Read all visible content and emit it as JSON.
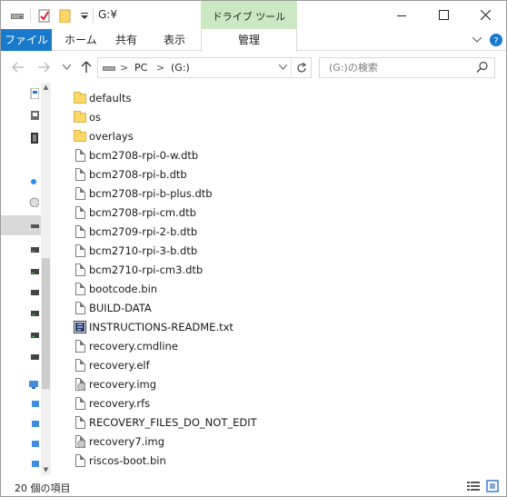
{
  "window": {
    "title": "G:¥",
    "context_tab": "ドライブ ツール"
  },
  "ribbon": {
    "file_tab": "ファイル",
    "tabs": [
      "ホーム",
      "共有",
      "表示"
    ],
    "manage_tab": "管理"
  },
  "address": {
    "segments": [
      "PC",
      "(G:)"
    ],
    "separator": ">"
  },
  "search": {
    "placeholder": "(G:)の検索"
  },
  "files": [
    {
      "name": "defaults",
      "type": "folder"
    },
    {
      "name": "os",
      "type": "folder"
    },
    {
      "name": "overlays",
      "type": "folder"
    },
    {
      "name": "bcm2708-rpi-0-w.dtb",
      "type": "file"
    },
    {
      "name": "bcm2708-rpi-b.dtb",
      "type": "file"
    },
    {
      "name": "bcm2708-rpi-b-plus.dtb",
      "type": "file"
    },
    {
      "name": "bcm2708-rpi-cm.dtb",
      "type": "file"
    },
    {
      "name": "bcm2709-rpi-2-b.dtb",
      "type": "file"
    },
    {
      "name": "bcm2710-rpi-3-b.dtb",
      "type": "file"
    },
    {
      "name": "bcm2710-rpi-cm3.dtb",
      "type": "file"
    },
    {
      "name": "bootcode.bin",
      "type": "file"
    },
    {
      "name": "BUILD-DATA",
      "type": "file"
    },
    {
      "name": "INSTRUCTIONS-README.txt",
      "type": "text"
    },
    {
      "name": "recovery.cmdline",
      "type": "file"
    },
    {
      "name": "recovery.elf",
      "type": "file"
    },
    {
      "name": "recovery.img",
      "type": "image"
    },
    {
      "name": "recovery.rfs",
      "type": "file"
    },
    {
      "name": "RECOVERY_FILES_DO_NOT_EDIT",
      "type": "file"
    },
    {
      "name": "recovery7.img",
      "type": "image"
    },
    {
      "name": "riscos-boot.bin",
      "type": "file"
    }
  ],
  "status": {
    "item_count": "20 個の項目"
  },
  "colors": {
    "file_tab_bg": "#1979ca",
    "context_tab_bg": "#cbe8c2",
    "folder": "#ffd766"
  }
}
